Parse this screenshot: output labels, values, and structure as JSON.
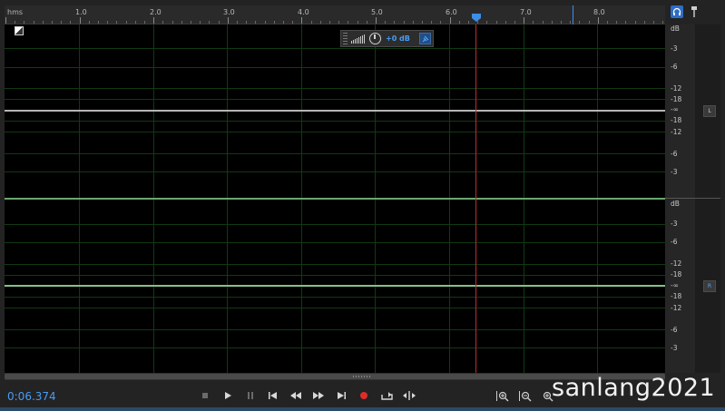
{
  "ruler": {
    "unit": "hms",
    "ticks": [
      "1.0",
      "2.0",
      "3.0",
      "4.0",
      "5.0",
      "6.0",
      "7.0",
      "8.0"
    ]
  },
  "hud": {
    "gain_label": "+0 dB"
  },
  "db_scale_left": [
    "dB",
    "-3",
    "-6",
    "-12",
    "-18",
    "-∞",
    "-18",
    "-12",
    "-6",
    "-3"
  ],
  "db_scale_right": [
    "dB",
    "-3",
    "-6",
    "-12",
    "-18",
    "-∞",
    "-18",
    "-12",
    "-6",
    "-3"
  ],
  "channels": {
    "left": "L",
    "right": "R"
  },
  "transport": {
    "time": "0:06.374",
    "buttons": [
      "stop",
      "play",
      "pause",
      "move-to-previous",
      "rewind",
      "fast-forward",
      "move-to-next",
      "record",
      "loop",
      "skip-selection"
    ]
  },
  "zoom_tools": [
    "zoom-in-amplitude",
    "zoom-out-amplitude",
    "zoom-in-time"
  ],
  "watermark": "sanlang2021",
  "colors": {
    "accent": "#4a9cf5",
    "playhead": "#c4262c",
    "waveform": "#86c08a"
  },
  "icons": [
    "headphones-icon",
    "pin-icon",
    "pin-hud-icon",
    "knob-icon",
    "volume-bars-icon"
  ]
}
